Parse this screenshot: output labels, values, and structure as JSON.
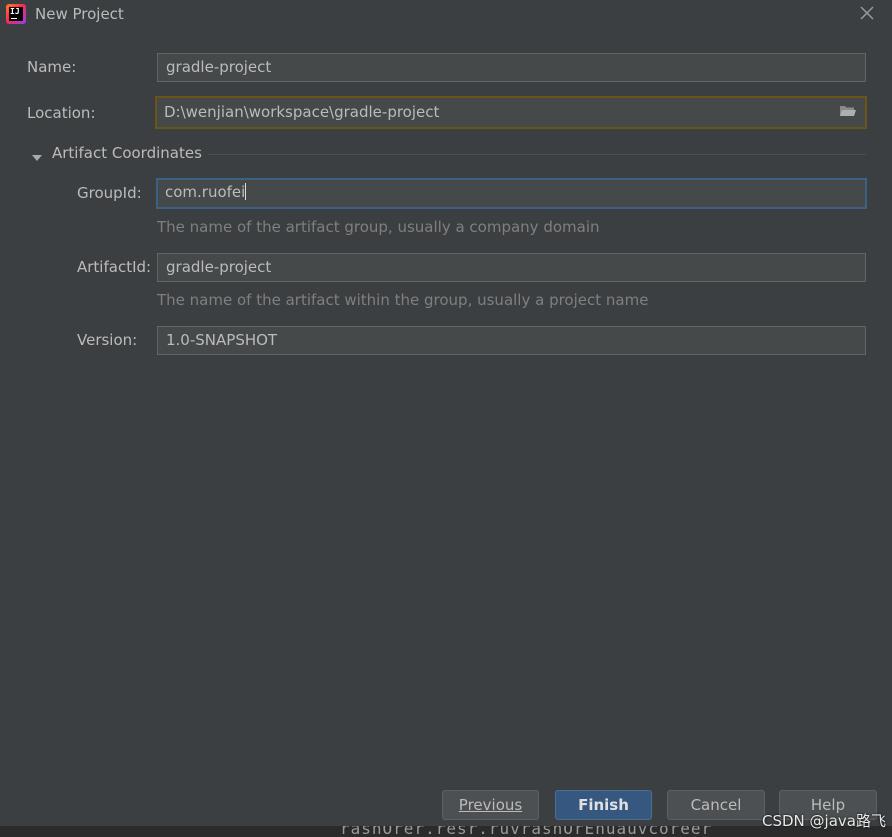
{
  "window": {
    "title": "New Project",
    "app_icon": "IJ"
  },
  "form": {
    "name_label": "Name:",
    "name_value": "gradle-project",
    "location_label": "Location:",
    "location_value": "D:\\wenjian\\workspace\\gradle-project",
    "section_title": "Artifact Coordinates",
    "groupid_label": "GroupId:",
    "groupid_value": "com.ruofei",
    "groupid_hint": "The name of the artifact group, usually a company domain",
    "artifactid_label": "ArtifactId:",
    "artifactid_value": "gradle-project",
    "artifactid_hint": "The name of the artifact within the group, usually a project name",
    "version_label": "Version:",
    "version_value": "1.0-SNAPSHOT"
  },
  "buttons": {
    "previous": "Previous",
    "finish": "Finish",
    "cancel": "Cancel",
    "help": "Help"
  },
  "background": {
    "partial_text": "rasnOrer.resr.ruvrasnOrEnuauvcoreer"
  },
  "watermark": "CSDN @java路飞",
  "icons": [
    "intellij-app-icon",
    "close-icon",
    "folder-icon",
    "triangle-down-icon"
  ],
  "colors": {
    "dialog_bg": "#3c3f41",
    "field_bg": "#45494a",
    "primary_button": "#365880",
    "focus_border": "#3d6185"
  }
}
